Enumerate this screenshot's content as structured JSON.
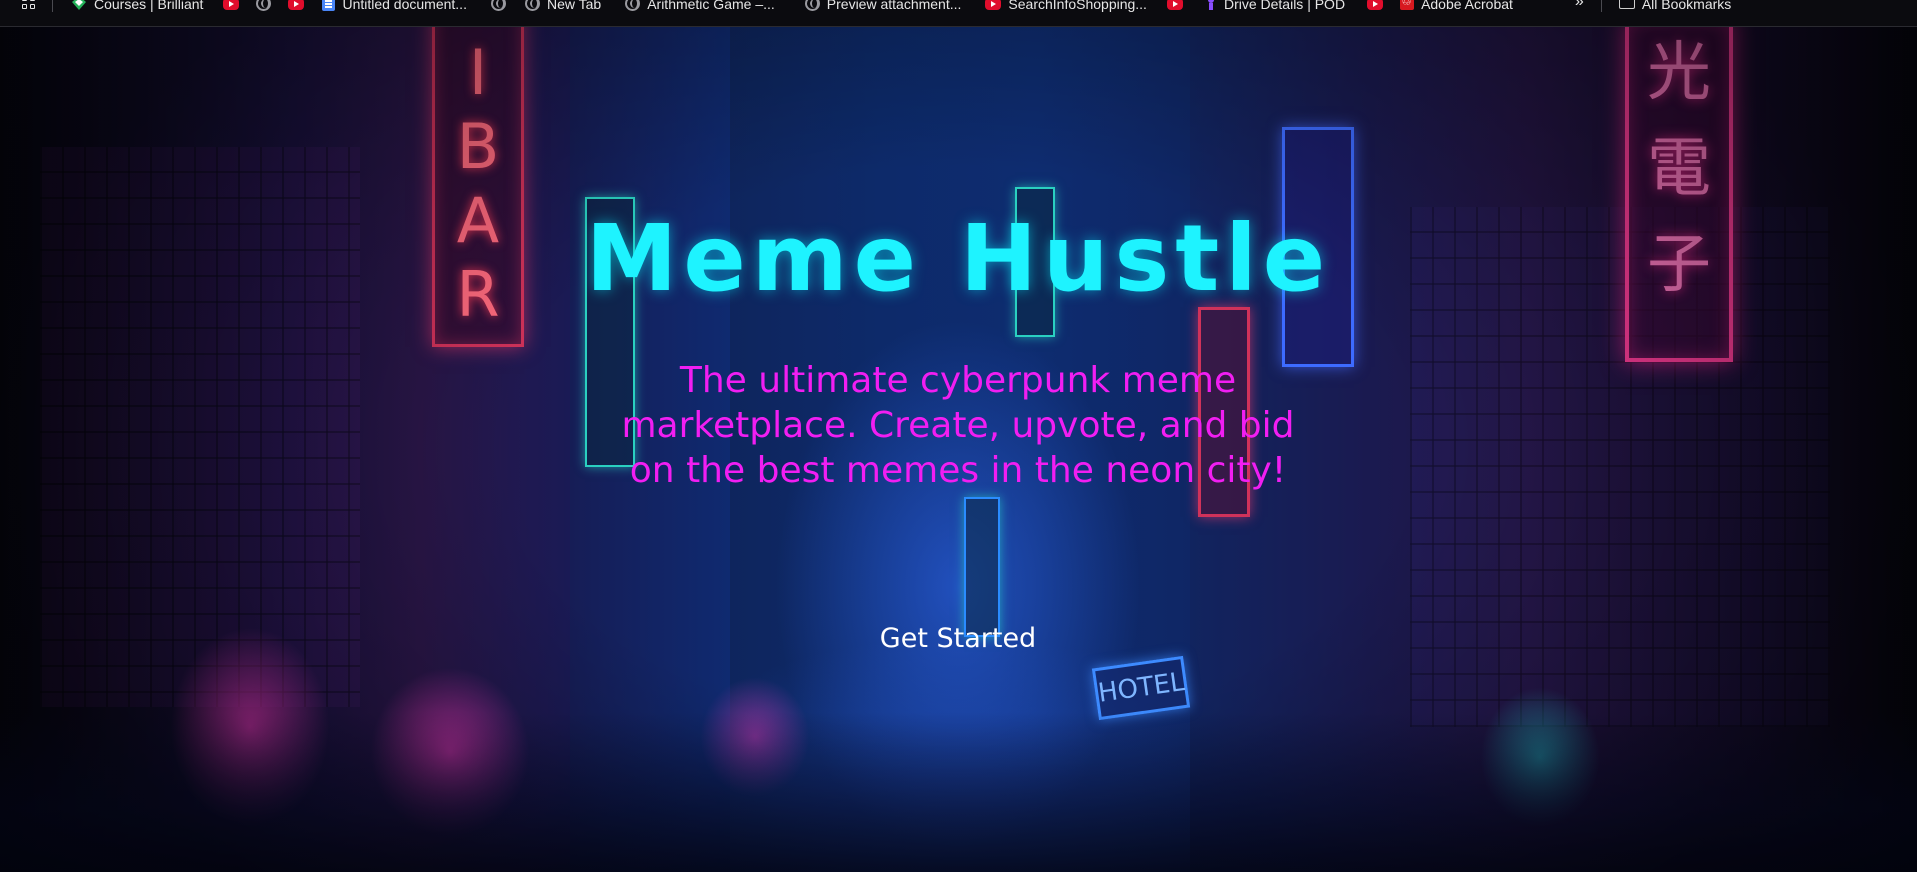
{
  "bookmarks_bar": {
    "items": [
      {
        "label": "",
        "icon": "apps-grid-icon"
      },
      {
        "label": "Courses | Brilliant",
        "icon": "brilliant-icon"
      },
      {
        "label": "",
        "icon": "youtube-icon"
      },
      {
        "label": "",
        "icon": "globe-icon"
      },
      {
        "label": "",
        "icon": "youtube-icon"
      },
      {
        "label": "Untitled document...",
        "icon": "google-docs-icon"
      },
      {
        "label": "",
        "icon": "globe-icon"
      },
      {
        "label": "New Tab",
        "icon": "globe-icon"
      },
      {
        "label": "Arithmetic Game –...",
        "icon": "globe-icon"
      },
      {
        "label": "Preview attachment...",
        "icon": "globe-icon"
      },
      {
        "label": "SearchInfoShopping...",
        "icon": "youtube-icon"
      },
      {
        "label": "",
        "icon": "youtube-icon"
      },
      {
        "label": "Drive Details | POD",
        "icon": "pod-icon"
      },
      {
        "label": "",
        "icon": "youtube-icon"
      },
      {
        "label": "Adobe Acrobat",
        "icon": "acrobat-icon"
      }
    ],
    "overflow_label": "»",
    "all_bookmarks_label": "All Bookmarks"
  },
  "hero": {
    "title": "Meme Hustle",
    "subtitle": "The ultimate cyberpunk meme marketplace. Create, upvote, and bid on the best memes in the neon city!",
    "cta_label": "Get Started"
  },
  "colors": {
    "title": "#1ef3ff",
    "subtitle": "#f11ef2",
    "cta_text": "#ffffff",
    "bar_background": "#0b0b0f"
  }
}
